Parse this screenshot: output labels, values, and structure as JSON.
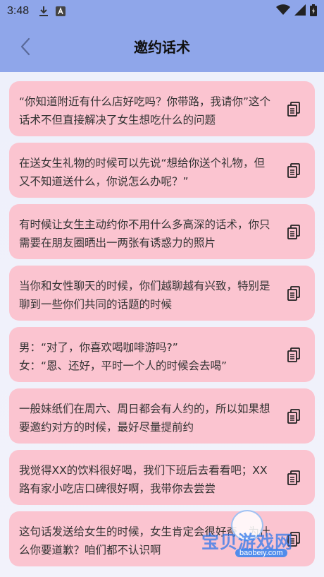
{
  "status": {
    "time": "3:48"
  },
  "header": {
    "title": "邀约话术"
  },
  "cards": [
    {
      "text": "“你知道附近有什么店好吃吗？你带路，我请你”这个话术不但直接解决了女生想吃什么的问题"
    },
    {
      "text": "在送女生礼物的时候可以先说“想给你送个礼物，但又不知道送什么，你说怎么办呢？”"
    },
    {
      "text": "有时候让女生主动约你不用什么多高深的话术，你只需要在朋友圈晒出一两张有诱惑力的照片"
    },
    {
      "text": "当你和女性聊天的时候，你们越聊越有兴致，特别是聊到一些你们共同的话题的时候"
    },
    {
      "text": "男：“对了，你喜欢喝咖啡游吗?”\n女：“恩、还好，平时一个人的时候会去喝”"
    },
    {
      "text": "一般妹纸们在周六、周日都会有人约的，所以如果想要邀约对方的时候，最好尽量提前约"
    },
    {
      "text": "我觉得XX的饮料很好喝，我们下班后去看看吧；XX路有家小吃店口碑很好啊，我带你去尝尝"
    },
    {
      "text": "这句话发送给女生的时候，女生肯定会很好奇，为什么你要道歉？咱们都不认识啊"
    }
  ],
  "watermark": {
    "name": "宝贝游戏网",
    "url": "baobeiy.com"
  }
}
